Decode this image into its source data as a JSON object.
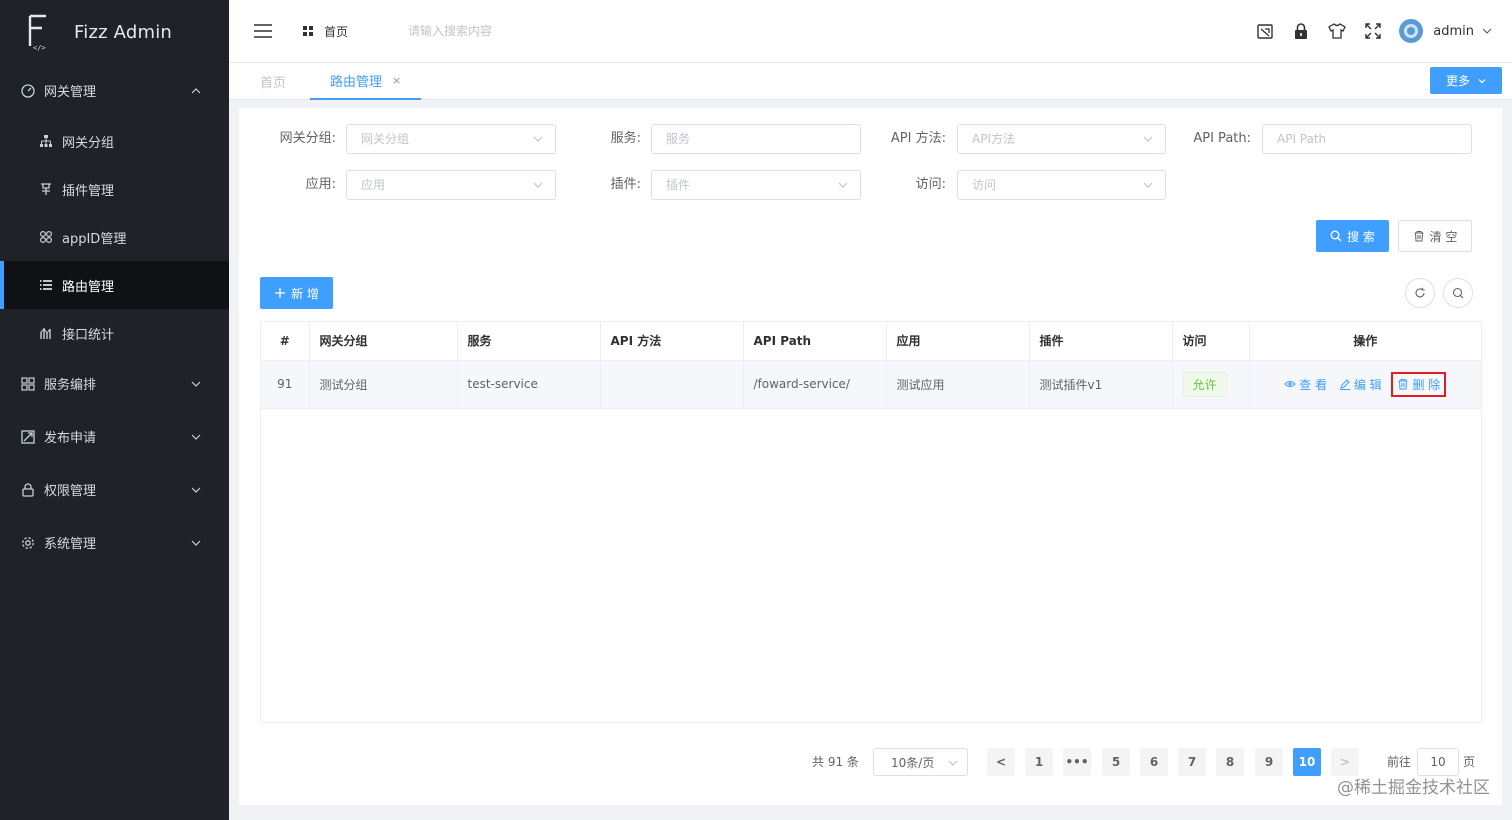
{
  "app": {
    "title": "Fizz Admin",
    "logo_glyph": "F"
  },
  "sidebar": {
    "groups": [
      {
        "label": "网关管理",
        "icon": "dashboard-icon",
        "expanded": true,
        "items": [
          {
            "label": "网关分组",
            "icon": "tree-icon"
          },
          {
            "label": "插件管理",
            "icon": "plugin-icon"
          },
          {
            "label": "appID管理",
            "icon": "apps-icon"
          },
          {
            "label": "路由管理",
            "icon": "list-icon",
            "active": true
          },
          {
            "label": "接口统计",
            "icon": "stats-icon"
          }
        ]
      },
      {
        "label": "服务编排",
        "icon": "grid-icon"
      },
      {
        "label": "发布申请",
        "icon": "publish-icon"
      },
      {
        "label": "权限管理",
        "icon": "lock-icon"
      },
      {
        "label": "系统管理",
        "icon": "gear-icon"
      }
    ]
  },
  "header": {
    "breadcrumb": "首页",
    "search_placeholder": "请输入搜索内容",
    "user": "admin",
    "tools": [
      "screenshot-icon",
      "lock-icon",
      "shirt-icon",
      "fullscreen-icon"
    ]
  },
  "tabs": {
    "home": "首页",
    "active": "路由管理",
    "close": "×",
    "more": "更多"
  },
  "filters": {
    "group": {
      "label": "网关分组:",
      "placeholder": "网关分组"
    },
    "service": {
      "label": "服务:",
      "placeholder": "服务"
    },
    "method": {
      "label": "API 方法:",
      "placeholder": "API方法"
    },
    "path": {
      "label": "API Path:",
      "placeholder": "API Path"
    },
    "app": {
      "label": "应用:",
      "placeholder": "应用"
    },
    "plugin": {
      "label": "插件:",
      "placeholder": "插件"
    },
    "access": {
      "label": "访问:",
      "placeholder": "访问"
    }
  },
  "actions": {
    "search": "搜 索",
    "clear": "清 空",
    "add": "新 增"
  },
  "table": {
    "headers": [
      "#",
      "网关分组",
      "服务",
      "API 方法",
      "API Path",
      "应用",
      "插件",
      "访问",
      "操作"
    ],
    "rows": [
      {
        "id": "91",
        "group": "测试分组",
        "service": "test-service",
        "method": "",
        "path": "/foward-service/",
        "app": "测试应用",
        "plugin": "测试插件v1",
        "access": "允许",
        "ops": {
          "view": "查 看",
          "edit": "编 辑",
          "delete": "删 除"
        }
      }
    ]
  },
  "pagination": {
    "total": "共 91 条",
    "page_size": "10条/页",
    "pages": [
      "1",
      "•••",
      "5",
      "6",
      "7",
      "8",
      "9",
      "10"
    ],
    "current": "10",
    "prev": "<",
    "next": ">",
    "goto_label": "前往",
    "goto_value": "10",
    "page_suffix": "页"
  },
  "watermark": "@稀土掘金技术社区",
  "colors": {
    "primary": "#409eff",
    "sidebar_bg": "#1f2329",
    "success": "#67c23a",
    "danger": "#e02020"
  }
}
